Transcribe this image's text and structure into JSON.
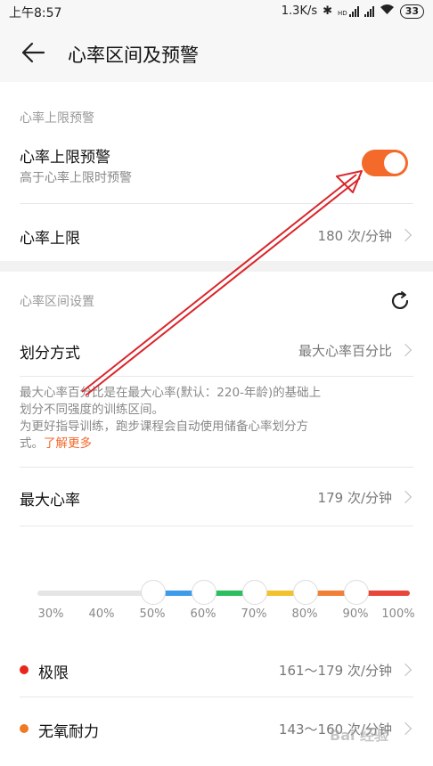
{
  "status": {
    "time": "上午8:57",
    "speed": "1.3K/s",
    "battery": "33",
    "hd": "HD"
  },
  "header": {
    "title": "心率区间及预警"
  },
  "alarm": {
    "section_label": "心率上限预警",
    "toggle_title": "心率上限预警",
    "toggle_sub": "高于心率上限时预警",
    "toggle_on": true,
    "limit_label": "心率上限",
    "limit_value": "180 次/分钟"
  },
  "zones_settings": {
    "section_label": "心率区间设置",
    "method_label": "划分方式",
    "method_value": "最大心率百分比",
    "desc_line1": "最大心率百分比是在最大心率(默认：220-年龄)的基础上",
    "desc_line2": "划分不同强度的训练区间。",
    "desc_line3": "为更好指导训练，跑步课程会自动使用储备心率划分方",
    "desc_line4": "式。",
    "desc_link": "了解更多",
    "max_label": "最大心率",
    "max_value": "179 次/分钟"
  },
  "slider": {
    "ticks": [
      "30%",
      "40%",
      "50%",
      "60%",
      "70%",
      "80%",
      "90%",
      "100%"
    ],
    "colors": {
      "gray": "#e5e5e5",
      "blue": "#3d9be9",
      "green": "#2dbe60",
      "yellow": "#f2c12e",
      "orange": "#f08037",
      "red": "#e8463a"
    }
  },
  "zones": [
    {
      "name": "极限",
      "range": "161～179 次/分钟",
      "color": "#e8261a"
    },
    {
      "name": "无氧耐力",
      "range": "143～160 次/分钟",
      "color": "#f07a22"
    }
  ],
  "accent": "#f36a2a",
  "watermark": "Bai 经验"
}
